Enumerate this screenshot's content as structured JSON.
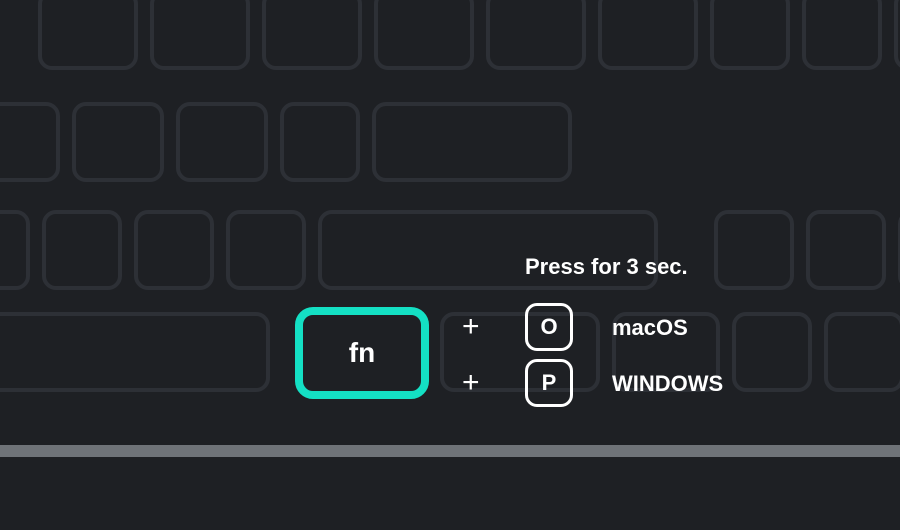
{
  "fn_label": "fn",
  "instruction": "Press for 3 sec.",
  "plus_symbol": "+",
  "combo_mac": {
    "key": "O",
    "os": "macOS"
  },
  "combo_win": {
    "key": "P",
    "os": "WINDOWS"
  },
  "colors": {
    "accent": "#14e0c4",
    "bg": "#1e2024",
    "key_outline": "#2d3036"
  }
}
